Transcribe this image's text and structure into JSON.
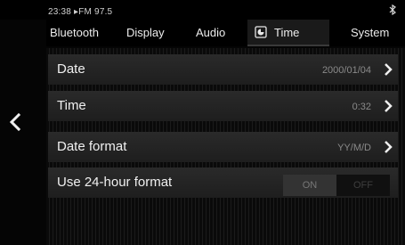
{
  "status": {
    "time": "23:38",
    "source": "▸FM 97.5",
    "bluetooth_icon": "bluetooth-icon"
  },
  "tabs": [
    {
      "label": "Bluetooth",
      "active": false
    },
    {
      "label": "Display",
      "active": false
    },
    {
      "label": "Audio",
      "active": false
    },
    {
      "label": "Time",
      "active": true,
      "icon": "clock-icon"
    },
    {
      "label": "System",
      "active": false
    }
  ],
  "settings": [
    {
      "label": "Date",
      "value": "2000/01/04",
      "has_chevron": true
    },
    {
      "label": "Time",
      "value": "0:32",
      "has_chevron": true
    },
    {
      "label": "Date format",
      "value": "YY/M/D",
      "has_chevron": true
    },
    {
      "label": "Use 24-hour format",
      "toggle": {
        "on_label": "ON",
        "off_label": "OFF",
        "state": "on"
      }
    }
  ],
  "colors": {
    "background": "#050505",
    "row": "#262626",
    "text": "#f0f0f0",
    "value_text": "#8a8a8a"
  }
}
